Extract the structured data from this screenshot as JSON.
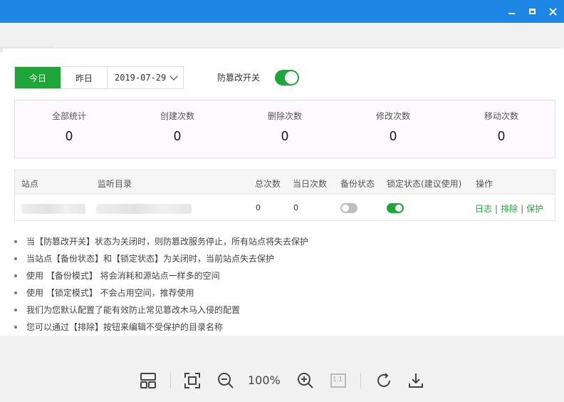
{
  "window": {
    "minimize": "minimize",
    "maximize": "maximize",
    "close": "close"
  },
  "colors": {
    "titlebar": "#1e87e6",
    "accent": "#20a53a",
    "toggle_off": "#bfbfbf"
  },
  "date": {
    "today": "今日",
    "yesterday": "昨日",
    "value": "2019-07-29"
  },
  "tamper": {
    "label": "防篡改开关",
    "enabled": true
  },
  "stats": [
    {
      "label": "全部统计",
      "value": "0"
    },
    {
      "label": "创建次数",
      "value": "0"
    },
    {
      "label": "删除次数",
      "value": "0"
    },
    {
      "label": "修改次数",
      "value": "0"
    },
    {
      "label": "移动次数",
      "value": "0"
    }
  ],
  "table": {
    "headers": {
      "site": "站点",
      "dir": "监听目录",
      "total": "总次数",
      "today": "当日次数",
      "backup": "备份状态",
      "lock": "锁定状态(建议使用)",
      "ops": "操作"
    },
    "rows": [
      {
        "total": "0",
        "today": "0",
        "backup": false,
        "lock": true
      }
    ],
    "actions": {
      "log": "日志",
      "exclude": "排除",
      "protect": "保护",
      "sep": "|"
    }
  },
  "notes": [
    "当【防篡改开关】状态为关闭时，则防篡改服务停止，所有站点将失去保护",
    "当站点【备份状态】和【锁定状态】为关闭时，当前站点失去保护",
    "使用 【备份模式】 将会消耗和源站点一样多的空间",
    "使用 【锁定模式】 不会占用空间，推荐使用",
    "我们为您默认配置了能有效防止常见篡改木马入侵的配置",
    "您可以通过【排除】按钮来编辑不受保护的目录名称"
  ],
  "viewer": {
    "zoom": "100%",
    "one_to_one": "1:1"
  }
}
